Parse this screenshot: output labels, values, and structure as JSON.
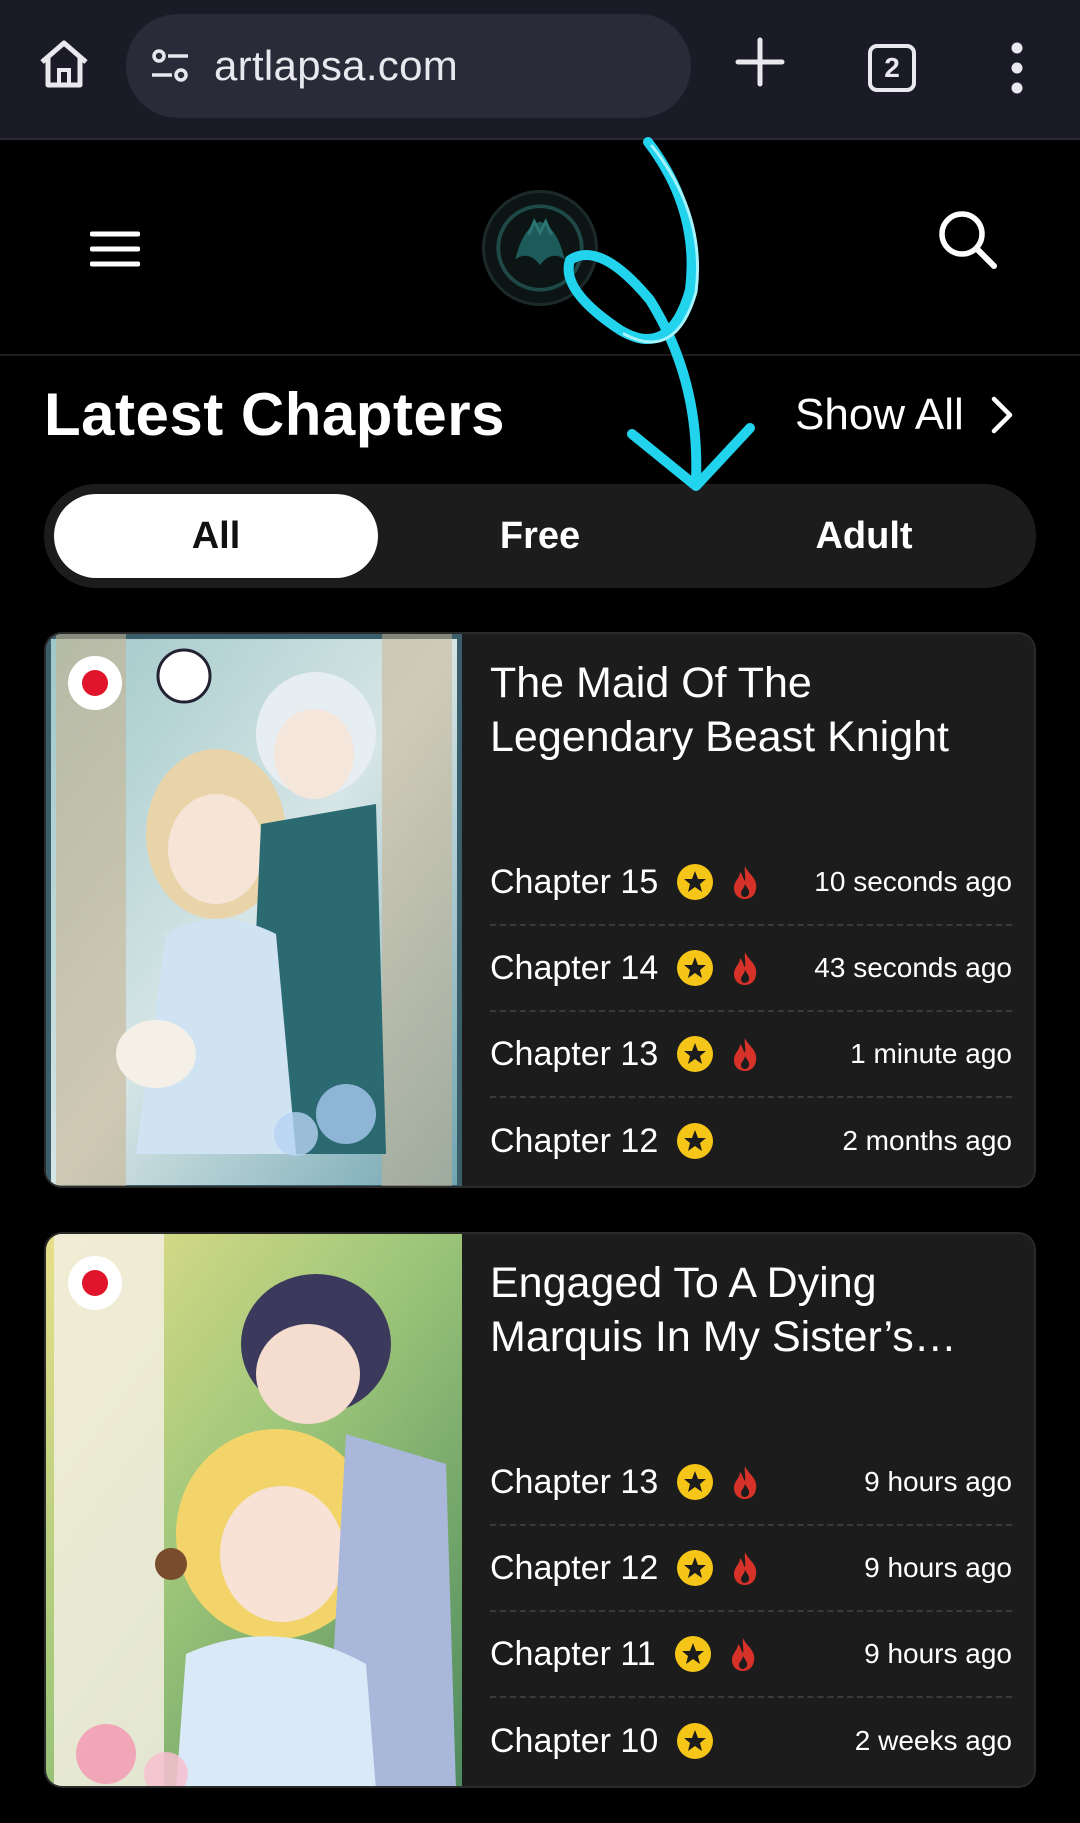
{
  "browser": {
    "url": "artlapsa.com",
    "tab_count": "2",
    "icons": [
      "home-icon",
      "site-info-icon",
      "plus-icon",
      "tabs-icon",
      "more-vert-icon"
    ]
  },
  "site_header": {
    "icons": [
      "hamburger-menu-icon",
      "site-logo",
      "search-icon"
    ]
  },
  "section": {
    "title": "Latest Chapters",
    "show_all": "Show All"
  },
  "filters": {
    "tabs": [
      "All",
      "Free",
      "Adult"
    ],
    "selected": "All"
  },
  "colors": {
    "accent_star": "#f5c518",
    "accent_fire": "#d6322a",
    "flag_red": "#e0152b",
    "annotation": "#22d3ee"
  },
  "series": [
    {
      "title": "The Maid Of The Legendary Beast Knight",
      "flag": "japan",
      "chapters": [
        {
          "name": "Chapter 15",
          "time": "10 seconds ago",
          "hot": true
        },
        {
          "name": "Chapter 14",
          "time": "43 seconds ago",
          "hot": true
        },
        {
          "name": "Chapter 13",
          "time": "1 minute ago",
          "hot": true
        },
        {
          "name": "Chapter 12",
          "time": "2 months ago",
          "hot": false
        }
      ]
    },
    {
      "title": "Engaged To A Dying Marquis In My Sister’s…",
      "flag": "japan",
      "chapters": [
        {
          "name": "Chapter 13",
          "time": "9 hours ago",
          "hot": true
        },
        {
          "name": "Chapter 12",
          "time": "9 hours ago",
          "hot": true
        },
        {
          "name": "Chapter 11",
          "time": "9 hours ago",
          "hot": true
        },
        {
          "name": "Chapter 10",
          "time": "2 weeks ago",
          "hot": false
        }
      ]
    }
  ]
}
